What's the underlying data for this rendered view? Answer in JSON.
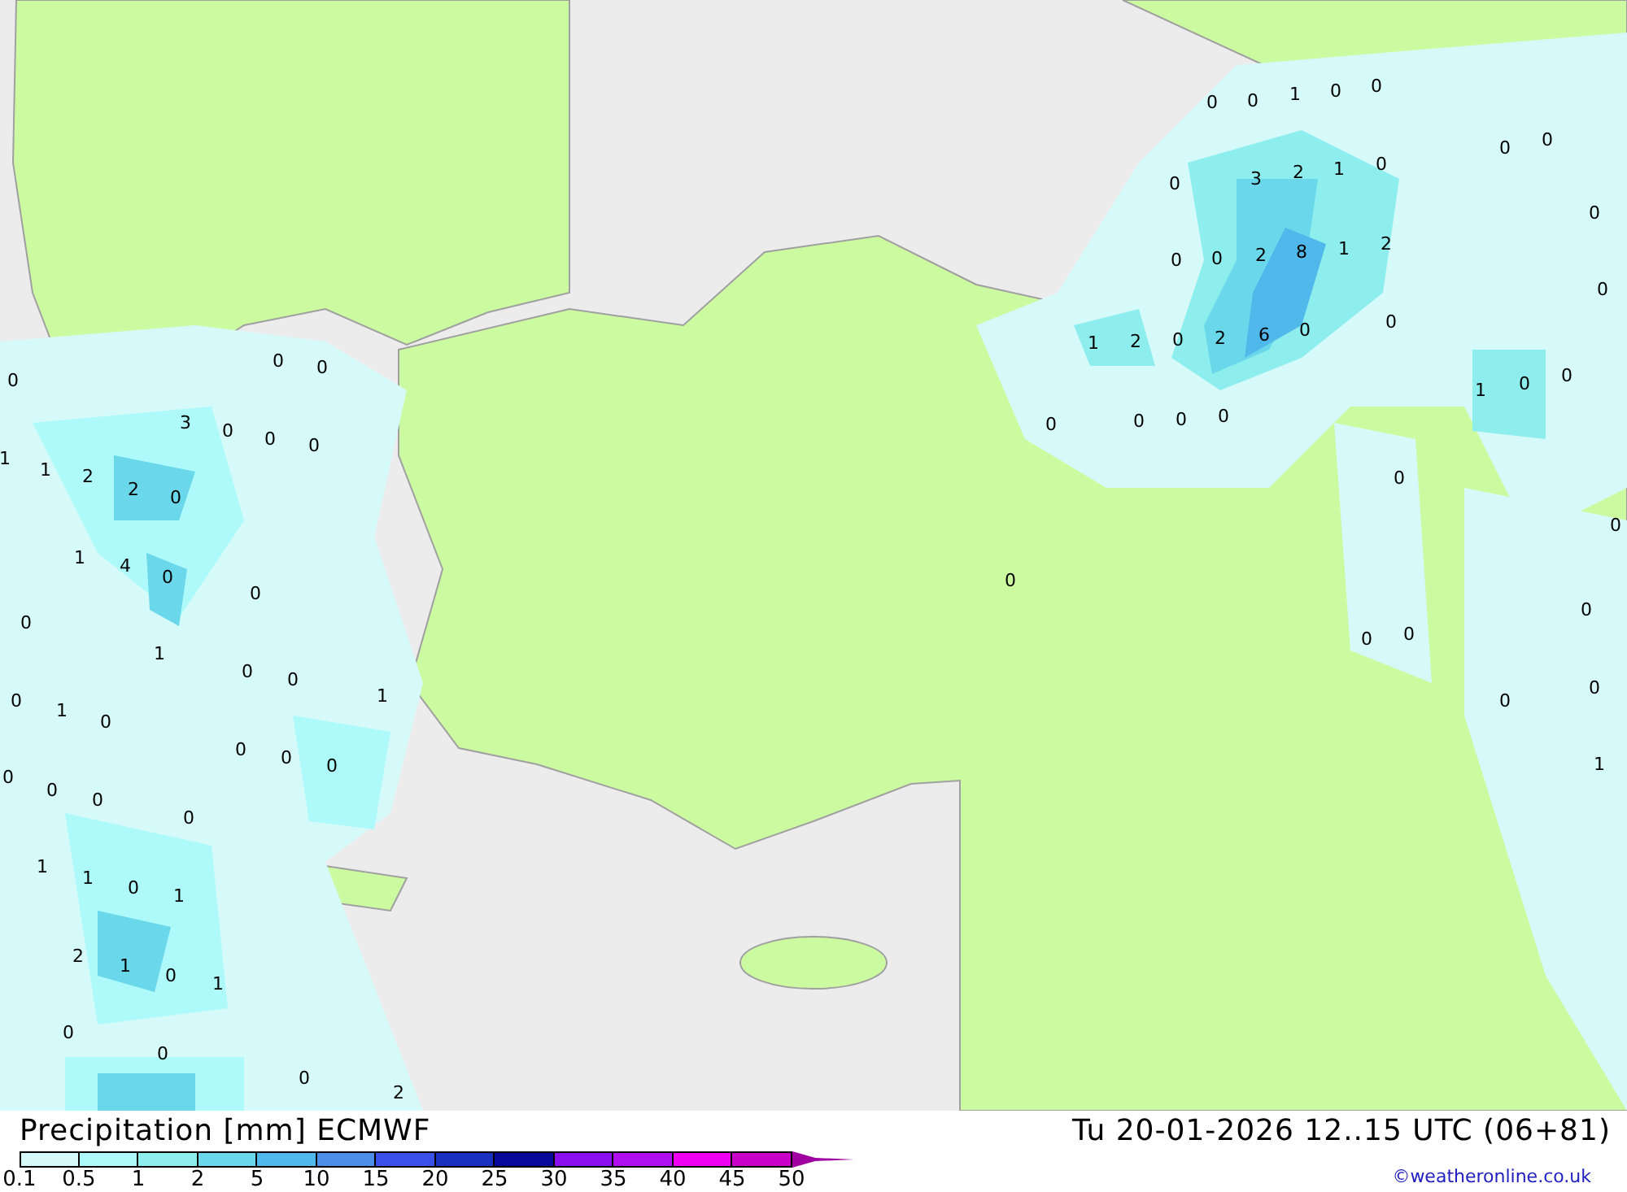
{
  "map": {
    "labels": [
      "0",
      "0",
      "1",
      "0",
      "0",
      "0",
      "3",
      "2",
      "1",
      "0",
      "0",
      "0",
      "2",
      "8",
      "1",
      "2",
      "1",
      "2",
      "0",
      "2",
      "6",
      "0",
      "0",
      "0",
      "0",
      "0",
      "0",
      "0",
      "0",
      "0",
      "0",
      "1",
      "0",
      "0",
      "0",
      "0",
      "0",
      "0",
      "1",
      "0",
      "0",
      "0",
      "0",
      "0",
      "0",
      "0",
      "3",
      "0",
      "0",
      "0",
      "1",
      "1",
      "2",
      "2",
      "0",
      "1",
      "4",
      "0",
      "0",
      "0",
      "1",
      "0",
      "0",
      "0",
      "1",
      "0",
      "1",
      "0",
      "0",
      "0",
      "0",
      "0",
      "0",
      "0",
      "1",
      "1",
      "0",
      "1",
      "2",
      "1",
      "0",
      "1",
      "0",
      "0",
      "0",
      "2"
    ]
  },
  "footer": {
    "title": "Precipitation [mm] ECMWF",
    "datetime": "Tu 20-01-2026 12..15 UTC (06+81)",
    "credit": "©weatheronline.co.uk"
  },
  "legend": {
    "labels": [
      "0.1",
      "0.5",
      "1",
      "2",
      "5",
      "10",
      "15",
      "20",
      "25",
      "30",
      "35",
      "40",
      "45",
      "50"
    ],
    "bins": [
      {
        "color": "#d6fafa"
      },
      {
        "color": "#aefafa"
      },
      {
        "color": "#8eeeee"
      },
      {
        "color": "#6ad8ea"
      },
      {
        "color": "#50b8ea"
      },
      {
        "color": "#4c8ee8"
      },
      {
        "color": "#3a50e8"
      },
      {
        "color": "#1a30c0"
      },
      {
        "color": "#08089a"
      },
      {
        "color": "#8a10f0"
      },
      {
        "color": "#b010f0"
      },
      {
        "color": "#f000f0"
      },
      {
        "color": "#c800c8"
      }
    ],
    "arrow": {
      "color": "#a000a0"
    }
  }
}
